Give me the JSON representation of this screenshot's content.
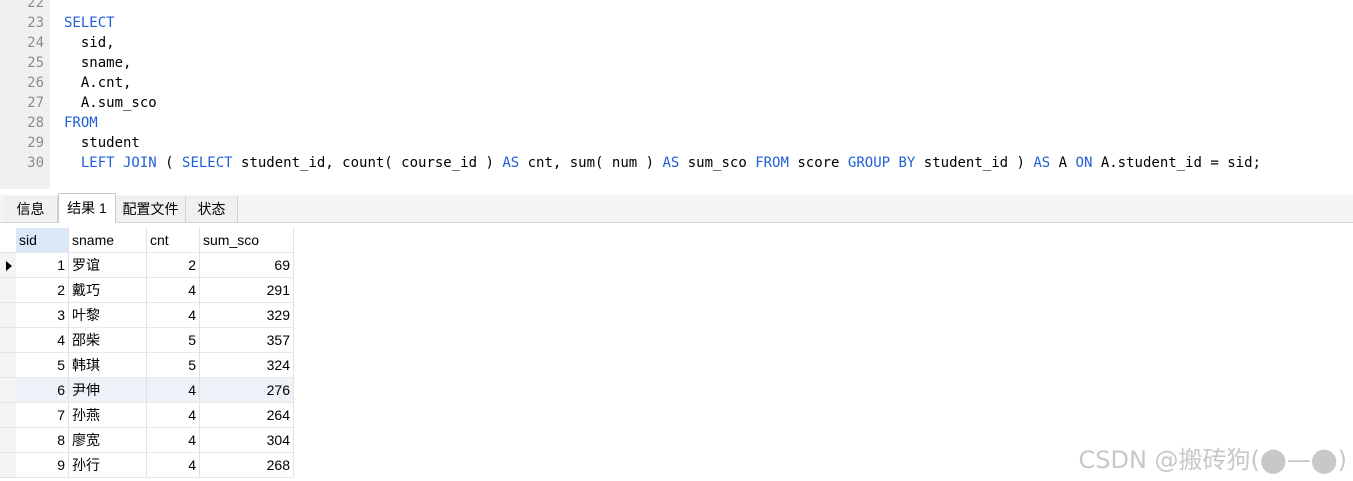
{
  "editor": {
    "lines": [
      {
        "num": "22",
        "parts": []
      },
      {
        "num": "23",
        "parts": [
          {
            "t": "SELECT",
            "kw": true
          }
        ]
      },
      {
        "num": "24",
        "parts": [
          {
            "t": "  sid,",
            "kw": false
          }
        ]
      },
      {
        "num": "25",
        "parts": [
          {
            "t": "  sname,",
            "kw": false
          }
        ]
      },
      {
        "num": "26",
        "parts": [
          {
            "t": "  A.cnt,",
            "kw": false
          }
        ]
      },
      {
        "num": "27",
        "parts": [
          {
            "t": "  A.sum_sco",
            "kw": false
          }
        ]
      },
      {
        "num": "28",
        "parts": [
          {
            "t": "FROM",
            "kw": true
          }
        ]
      },
      {
        "num": "29",
        "parts": [
          {
            "t": "  student",
            "kw": false
          }
        ]
      },
      {
        "num": "30",
        "parts": [
          {
            "t": "  ",
            "kw": false
          },
          {
            "t": "LEFT JOIN",
            "kw": true
          },
          {
            "t": " ( ",
            "kw": false
          },
          {
            "t": "SELECT",
            "kw": true
          },
          {
            "t": " student_id, count( course_id ) ",
            "kw": false
          },
          {
            "t": "AS",
            "kw": true
          },
          {
            "t": " cnt, sum( num ) ",
            "kw": false
          },
          {
            "t": "AS",
            "kw": true
          },
          {
            "t": " sum_sco ",
            "kw": false
          },
          {
            "t": "FROM",
            "kw": true
          },
          {
            "t": " score ",
            "kw": false
          },
          {
            "t": "GROUP BY",
            "kw": true
          },
          {
            "t": " student_id ) ",
            "kw": false
          },
          {
            "t": "AS",
            "kw": true
          },
          {
            "t": " A ",
            "kw": false
          },
          {
            "t": "ON",
            "kw": true
          },
          {
            "t": " A.student_id = sid;",
            "kw": false
          }
        ]
      }
    ]
  },
  "tabs": [
    {
      "label": "信息",
      "active": false
    },
    {
      "label": "结果 1",
      "active": true
    },
    {
      "label": "配置文件",
      "active": false
    },
    {
      "label": "状态",
      "active": false
    }
  ],
  "result": {
    "columns": [
      "sid",
      "sname",
      "cnt",
      "sum_sco"
    ],
    "rows": [
      [
        "1",
        "罗谊",
        "2",
        "69"
      ],
      [
        "2",
        "戴巧",
        "4",
        "291"
      ],
      [
        "3",
        "叶黎",
        "4",
        "329"
      ],
      [
        "4",
        "邵柴",
        "5",
        "357"
      ],
      [
        "5",
        "韩琪",
        "5",
        "324"
      ],
      [
        "6",
        "尹伸",
        "4",
        "276"
      ],
      [
        "7",
        "孙燕",
        "4",
        "264"
      ],
      [
        "8",
        "廖宽",
        "4",
        "304"
      ],
      [
        "9",
        "孙行",
        "4",
        "268"
      ]
    ],
    "current_row": 1,
    "highlighted_row": 6
  },
  "watermark": "CSDN @搬砖狗(⬤—⬤)",
  "colors": {
    "keyword": "#1f5fd6",
    "gutter": "#f0f0f0",
    "selected_header": "#dbe8f7"
  }
}
